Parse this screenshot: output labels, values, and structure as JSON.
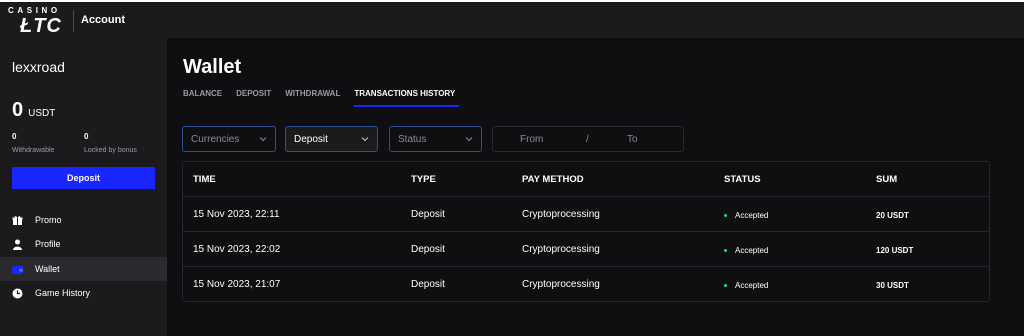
{
  "brand": {
    "top": "CASINO",
    "main": "ŁTC"
  },
  "header": {
    "title": "Account"
  },
  "sidebar": {
    "username": "lexxroad",
    "balance": {
      "amount": "0",
      "currency": "USDT"
    },
    "withdrawable": {
      "value": "0",
      "label": "Withdrawable"
    },
    "locked": {
      "value": "0",
      "label": "Locked by bonus"
    },
    "deposit_label": "Deposit",
    "nav": [
      {
        "label": "Promo",
        "icon": "gift-icon"
      },
      {
        "label": "Profile",
        "icon": "user-icon"
      },
      {
        "label": "Wallet",
        "icon": "wallet-icon",
        "active": true
      },
      {
        "label": "Game History",
        "icon": "clock-icon"
      }
    ]
  },
  "main": {
    "title": "Wallet",
    "tabs": [
      "BALANCE",
      "DEPOSIT",
      "WITHDRAWAL",
      "TRANSACTIONS HISTORY"
    ],
    "active_tab": "TRANSACTIONS HISTORY",
    "filters": {
      "currencies": "Currencies",
      "type": "Deposit",
      "status": "Status",
      "from": "From",
      "sep": "/",
      "to": "To"
    },
    "table": {
      "headers": [
        "TIME",
        "TYPE",
        "PAY METHOD",
        "STATUS",
        "SUM"
      ],
      "rows": [
        {
          "time": "15 Nov 2023, 22:11",
          "type": "Deposit",
          "method": "Cryptoprocessing",
          "status": "Accepted",
          "sum": "20 USDT"
        },
        {
          "time": "15 Nov 2023, 22:02",
          "type": "Deposit",
          "method": "Cryptoprocessing",
          "status": "Accepted",
          "sum": "120 USDT"
        },
        {
          "time": "15 Nov 2023, 21:07",
          "type": "Deposit",
          "method": "Cryptoprocessing",
          "status": "Accepted",
          "sum": "30 USDT"
        }
      ]
    }
  },
  "colors": {
    "accent": "#1a26ff",
    "status_ok": "#1fd97a",
    "sidebar_bg": "#1b1b1e",
    "page_bg": "#0f0f12"
  }
}
